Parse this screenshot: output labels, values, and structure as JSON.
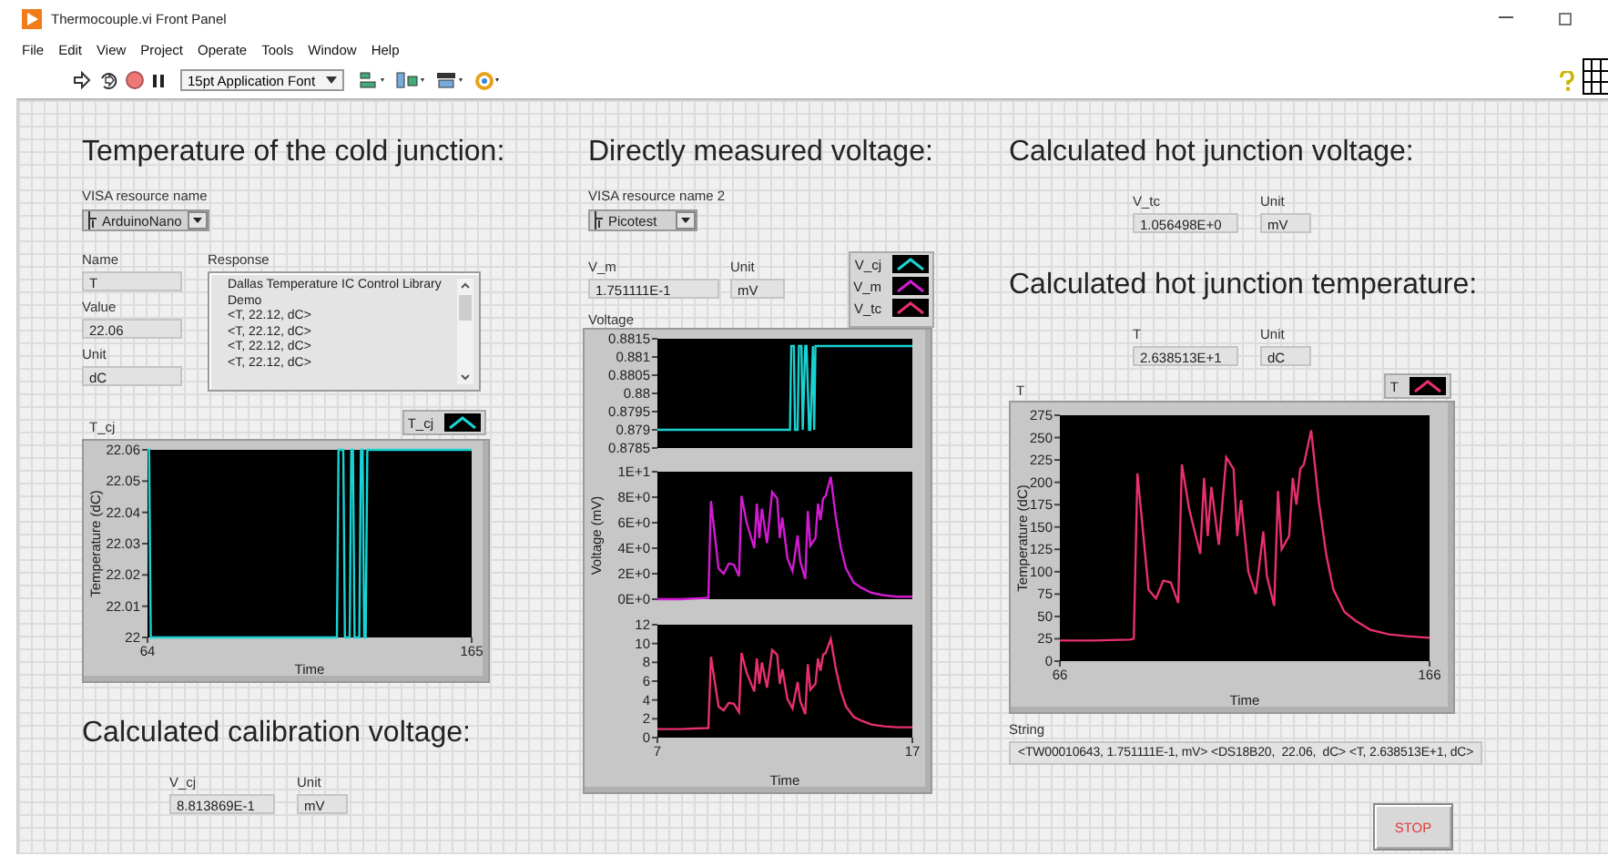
{
  "window": {
    "title": "Thermocouple.vi Front Panel"
  },
  "menu": [
    "File",
    "Edit",
    "View",
    "Project",
    "Operate",
    "Tools",
    "Window",
    "Help"
  ],
  "toolbar": {
    "font": "15pt Application Font"
  },
  "cold_junction": {
    "heading": "Temperature of the cold junction:",
    "visa": {
      "label": "VISA resource name",
      "value": "ArduinoNano"
    },
    "fields": [
      {
        "label": "Name",
        "value": "T"
      },
      {
        "label": "Value",
        "value": "22.06"
      },
      {
        "label": "Unit",
        "value": "dC"
      }
    ],
    "response": {
      "label": "Response",
      "lines": [
        "Dallas Temperature IC Control Library",
        "Demo",
        "<T, 22.12, dC>",
        "<T, 22.12, dC>",
        "<T, 22.12, dC>",
        "<T, 22.12, dC>"
      ]
    },
    "chart": {
      "label": "T_cj",
      "chart_data": {
        "type": "line",
        "xlabel": "Time",
        "ylabel": "Temperature (dC)",
        "xlim": [
          64,
          165
        ],
        "ylim": [
          22,
          22.06
        ],
        "xticks": [
          64,
          165
        ],
        "yticks": [
          22,
          22.01,
          22.02,
          22.03,
          22.04,
          22.05,
          22.06
        ],
        "x": [
          64,
          64.5,
          65,
          123,
          123.5,
          125,
          125.5,
          127,
          127.5,
          128,
          128.5,
          130,
          130.5,
          131,
          131.5,
          132,
          132.5,
          165
        ],
        "series": [
          {
            "name": "T_cj",
            "color": "#19d3d3",
            "values": [
              22.06,
              22.06,
              22,
              22,
              22.06,
              22.06,
              22,
              22,
              22.06,
              22.06,
              22,
              22,
              22.06,
              22.06,
              22,
              22,
              22.06,
              22.06
            ]
          }
        ]
      }
    }
  },
  "calibration": {
    "heading": "Calculated calibration voltage:",
    "fields": [
      {
        "label": "V_cj",
        "value": "8.813869E-1"
      },
      {
        "label": "Unit",
        "value": "mV"
      }
    ]
  },
  "measured": {
    "heading": "Directly measured voltage:",
    "visa": {
      "label": "VISA resource name 2",
      "value": "Picotest"
    },
    "fields": [
      {
        "label": "V_m",
        "value": "1.751111E-1"
      },
      {
        "label": "Unit",
        "value": "mV"
      }
    ],
    "chart": {
      "label": "Voltage",
      "plots": [
        {
          "chart_data": {
            "type": "line",
            "xlim": [
              7,
              17
            ],
            "ylim": [
              0.8785,
              0.8815
            ],
            "yticks": [
              0.8785,
              0.879,
              0.8795,
              0.88,
              0.8805,
              0.881,
              0.8815
            ],
            "x": [
              7,
              12.2,
              12.25,
              12.35,
              12.4,
              12.5,
              12.55,
              12.65,
              12.7,
              12.8,
              12.85,
              12.95,
              13,
              13.1,
              13.15,
              13.2,
              17
            ],
            "series": [
              {
                "name": "V_cj",
                "color": "#19d3d3",
                "values": [
                  0.879,
                  0.879,
                  0.8813,
                  0.8813,
                  0.879,
                  0.879,
                  0.8813,
                  0.8813,
                  0.879,
                  0.8813,
                  0.8813,
                  0.879,
                  0.879,
                  0.8813,
                  0.879,
                  0.8813,
                  0.8813
                ]
              }
            ]
          }
        },
        {
          "chart_data": {
            "type": "line",
            "ylabel": "Voltage (mV)",
            "xlim": [
              7,
              17
            ],
            "ylim": [
              0,
              10
            ],
            "yticks": [
              {
                "value": 0,
                "label": "0E+0"
              },
              {
                "value": 2,
                "label": "2E+0"
              },
              {
                "value": 4,
                "label": "4E+0"
              },
              {
                "value": 6,
                "label": "6E+0"
              },
              {
                "value": 8,
                "label": "8E+0"
              },
              {
                "value": 10,
                "label": "1E+1"
              }
            ],
            "x": [
              7,
              7.9,
              8.9,
              9,
              9.1,
              9.4,
              9.6,
              9.8,
              10,
              10.2,
              10.3,
              10.5,
              10.8,
              10.9,
              11,
              11.1,
              11.3,
              11.5,
              11.7,
              11.8,
              11.9,
              12.1,
              12.3,
              12.5,
              12.6,
              12.8,
              12.9,
              13,
              13.2,
              13.3,
              13.4,
              13.5,
              13.6,
              13.8,
              14,
              14.2,
              14.4,
              14.7,
              15,
              15.4,
              15.9,
              16.4,
              17
            ],
            "series": [
              {
                "name": "V_m",
                "color": "#d21bd2",
                "values": [
                  0,
                  0,
                  0.1,
                  0.1,
                  7.7,
                  2.4,
                  2.0,
                  2.8,
                  2.7,
                  1.8,
                  8.1,
                  6.0,
                  4.0,
                  7.5,
                  4.8,
                  7.1,
                  4.4,
                  8.4,
                  7.9,
                  4.8,
                  6.4,
                  3.2,
                  2.2,
                  5.0,
                  3.0,
                  1.6,
                  6.9,
                  4.2,
                  4.8,
                  7.5,
                  6.2,
                  7.9,
                  8.1,
                  9.6,
                  6.4,
                  4.0,
                  2.4,
                  1.3,
                  0.9,
                  0.5,
                  0.3,
                  0.2,
                  0.2
                ]
              }
            ]
          }
        },
        {
          "chart_data": {
            "type": "line",
            "xlabel": "Time",
            "xlim": [
              7,
              17
            ],
            "ylim": [
              0,
              12
            ],
            "xticks": [
              7,
              17
            ],
            "yticks": [
              0,
              2,
              4,
              6,
              8,
              10,
              12
            ],
            "x": [
              7,
              7.9,
              8.9,
              9,
              9.1,
              9.4,
              9.6,
              9.8,
              10,
              10.2,
              10.3,
              10.5,
              10.8,
              10.9,
              11,
              11.1,
              11.3,
              11.5,
              11.7,
              11.8,
              11.9,
              12.1,
              12.3,
              12.5,
              12.6,
              12.8,
              12.9,
              13,
              13.2,
              13.3,
              13.4,
              13.5,
              13.6,
              13.8,
              14,
              14.2,
              14.4,
              14.7,
              15,
              15.4,
              15.9,
              16.4,
              17
            ],
            "series": [
              {
                "name": "V_tc",
                "color": "#e8306e",
                "values": [
                  0.9,
                  0.9,
                  1.0,
                  1.0,
                  8.6,
                  3.3,
                  2.9,
                  3.7,
                  3.6,
                  2.7,
                  9.0,
                  6.9,
                  4.9,
                  8.4,
                  5.7,
                  8.0,
                  5.3,
                  9.3,
                  8.8,
                  5.7,
                  7.3,
                  4.1,
                  3.1,
                  5.9,
                  3.9,
                  2.5,
                  7.8,
                  5.1,
                  5.7,
                  8.4,
                  7.1,
                  8.8,
                  9.0,
                  10.5,
                  7.3,
                  4.9,
                  3.3,
                  2.2,
                  1.8,
                  1.4,
                  1.2,
                  1.1,
                  1.1
                ]
              }
            ]
          }
        }
      ]
    }
  },
  "hot_voltage": {
    "heading": "Calculated hot junction voltage:",
    "fields": [
      {
        "label": "V_tc",
        "value": "1.056498E+0"
      },
      {
        "label": "Unit",
        "value": "mV"
      }
    ]
  },
  "hot_temperature": {
    "heading": "Calculated hot junction temperature:",
    "fields": [
      {
        "label": "T",
        "value": "2.638513E+1"
      },
      {
        "label": "Unit",
        "value": "dC"
      }
    ],
    "chart": {
      "label": "T",
      "chart_data": {
        "type": "line",
        "xlabel": "Time",
        "ylabel": "Temperature (dC)",
        "xlim": [
          66,
          166
        ],
        "ylim": [
          0,
          275
        ],
        "xticks": [
          66,
          166
        ],
        "yticks": [
          0,
          25,
          50,
          75,
          100,
          125,
          150,
          175,
          200,
          225,
          250,
          275
        ],
        "x": [
          66,
          75,
          85,
          86,
          87,
          90,
          92,
          94,
          96,
          98,
          99,
          101,
          104,
          105,
          106,
          107,
          109,
          111,
          113,
          114,
          115,
          117,
          119,
          121,
          122,
          124,
          125,
          126,
          128,
          129,
          130,
          131,
          132,
          134,
          136,
          138,
          140,
          143,
          146,
          150,
          155,
          160,
          166
        ],
        "series": [
          {
            "name": "T",
            "color": "#e8306e",
            "values": [
              23,
              23,
              24,
              25,
              210,
              80,
              70,
              90,
              88,
              65,
              220,
              170,
              120,
              205,
              140,
              195,
              130,
              228,
              215,
              140,
              180,
              100,
              75,
              145,
              95,
              62,
              190,
              125,
              140,
              205,
              175,
              215,
              220,
              258,
              180,
              120,
              80,
              55,
              45,
              35,
              30,
              28,
              26
            ]
          }
        ]
      }
    }
  },
  "string": {
    "label": "String",
    "value": "<TW00010643, 1.751111E-1, mV> <DS18B20,  22.06,  dC> <T, 2.638513E+1, dC>"
  },
  "stop_button": "STOP"
}
